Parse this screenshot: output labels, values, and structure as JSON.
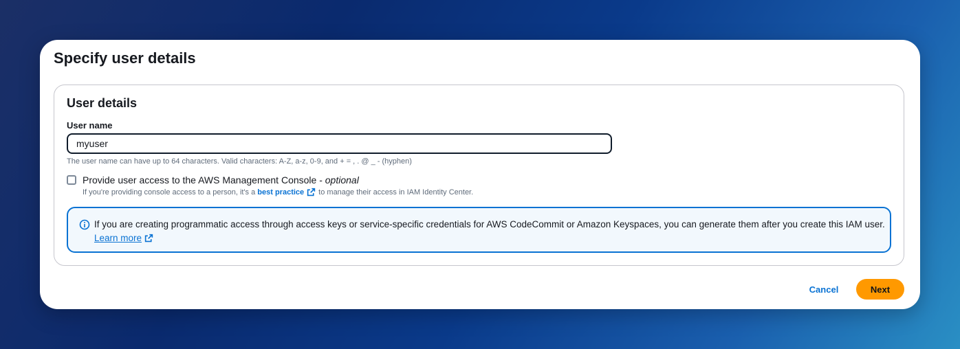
{
  "page": {
    "title": "Specify user details"
  },
  "user_details": {
    "heading": "User details",
    "user_name_label": "User name",
    "user_name_value": "myuser",
    "user_name_hint": "The user name can have up to 64 characters. Valid characters: A-Z, a-z, 0-9, and + = , . @ _ - (hyphen)"
  },
  "console_access": {
    "checked": false,
    "label": "Provide user access to the AWS Management Console - ",
    "label_optional": "optional",
    "desc_prefix": "If you're providing console access to a person, it's a",
    "desc_link": "best practice",
    "desc_suffix": "to manage their access in IAM Identity Center."
  },
  "info_alert": {
    "text": "If you are creating programmatic access through access keys or service-specific credentials for AWS CodeCommit or Amazon Keyspaces, you can generate them after you create this IAM user.",
    "link": "Learn more"
  },
  "footer": {
    "cancel_label": "Cancel",
    "next_label": "Next"
  },
  "colors": {
    "primary_link": "#0972d3",
    "next_button": "#ff9900",
    "info_border": "#0972d3",
    "info_background": "#f2f8fd"
  },
  "icons": [
    "external-link-icon",
    "info-icon"
  ]
}
